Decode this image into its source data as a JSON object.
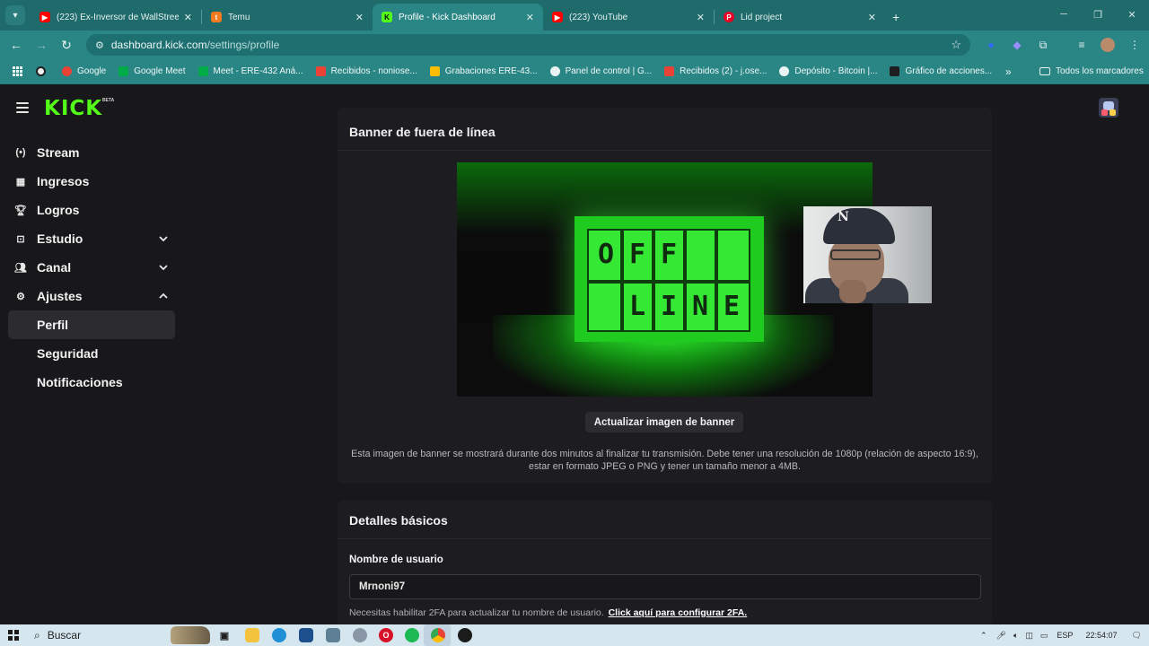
{
  "browser": {
    "tabs": [
      {
        "title": "(223) Ex-Inversor de WallStreet",
        "favicon": "youtube-icon",
        "color": "#ff0000"
      },
      {
        "title": "Temu",
        "favicon": "temu-icon",
        "color": "#f47a20"
      },
      {
        "title": "Profile - Kick Dashboard",
        "favicon": "kick-icon",
        "color": "#53fc18",
        "active": true
      },
      {
        "title": "(223) YouTube",
        "favicon": "youtube-icon",
        "color": "#ff0000"
      },
      {
        "title": "Lid project",
        "favicon": "pinterest-icon",
        "color": "#e60023"
      }
    ],
    "url_host": "dashboard.kick.com",
    "url_path": "/settings/profile",
    "bookmarks": [
      {
        "label": "Google"
      },
      {
        "label": "Google Meet"
      },
      {
        "label": "Meet - ERE-432 Aná..."
      },
      {
        "label": "Recibidos - noniose..."
      },
      {
        "label": "Grabaciones ERE-43..."
      },
      {
        "label": "Panel de control | G..."
      },
      {
        "label": "Recibidos (2) - j.ose..."
      },
      {
        "label": "Depósito - Bitcoin |..."
      },
      {
        "label": "Gráfico de acciones..."
      }
    ],
    "bookmarks_more": "»",
    "all_bookmarks": "Todos los marcadores"
  },
  "app": {
    "logo": "KICK",
    "logo_badge": "BETA",
    "accent": "#53fc18"
  },
  "sidebar": {
    "items": [
      {
        "label": "Stream",
        "icon": "broadcast-icon"
      },
      {
        "label": "Ingresos",
        "icon": "chart-icon"
      },
      {
        "label": "Logros",
        "icon": "trophy-icon"
      },
      {
        "label": "Estudio",
        "icon": "studio-icon",
        "expand": "chevron-down-icon"
      },
      {
        "label": "Canal",
        "icon": "users-icon",
        "expand": "chevron-down-icon"
      },
      {
        "label": "Ajustes",
        "icon": "gear-icon",
        "expand": "chevron-up-icon"
      }
    ],
    "subitems": [
      {
        "label": "Perfil",
        "selected": true
      },
      {
        "label": "Seguridad"
      },
      {
        "label": "Notificaciones"
      }
    ]
  },
  "banner": {
    "title": "Banner de fuera de línea",
    "image_letters_row1": [
      "O",
      "F",
      "F",
      ""
    ],
    "image_letters_row2": [
      "",
      "L",
      "I",
      "N",
      "E"
    ],
    "update_button": "Actualizar imagen de banner",
    "description": "Esta imagen de banner se mostrará durante dos minutos al finalizar tu transmisión. Debe tener una resolución de 1080p (relación de aspecto 16:9), estar en formato JPEG o PNG y tener un tamaño menor a 4MB."
  },
  "details": {
    "title": "Detalles básicos",
    "username_label": "Nombre de usuario",
    "username_value": "Mrnoni97",
    "help_text": "Necesitas habilitar 2FA para actualizar tu nombre de usuario.",
    "help_link": "Click aquí para configurar 2FA."
  },
  "taskbar": {
    "search_label": "Buscar",
    "language": "ESP",
    "time": "22:54:07"
  }
}
